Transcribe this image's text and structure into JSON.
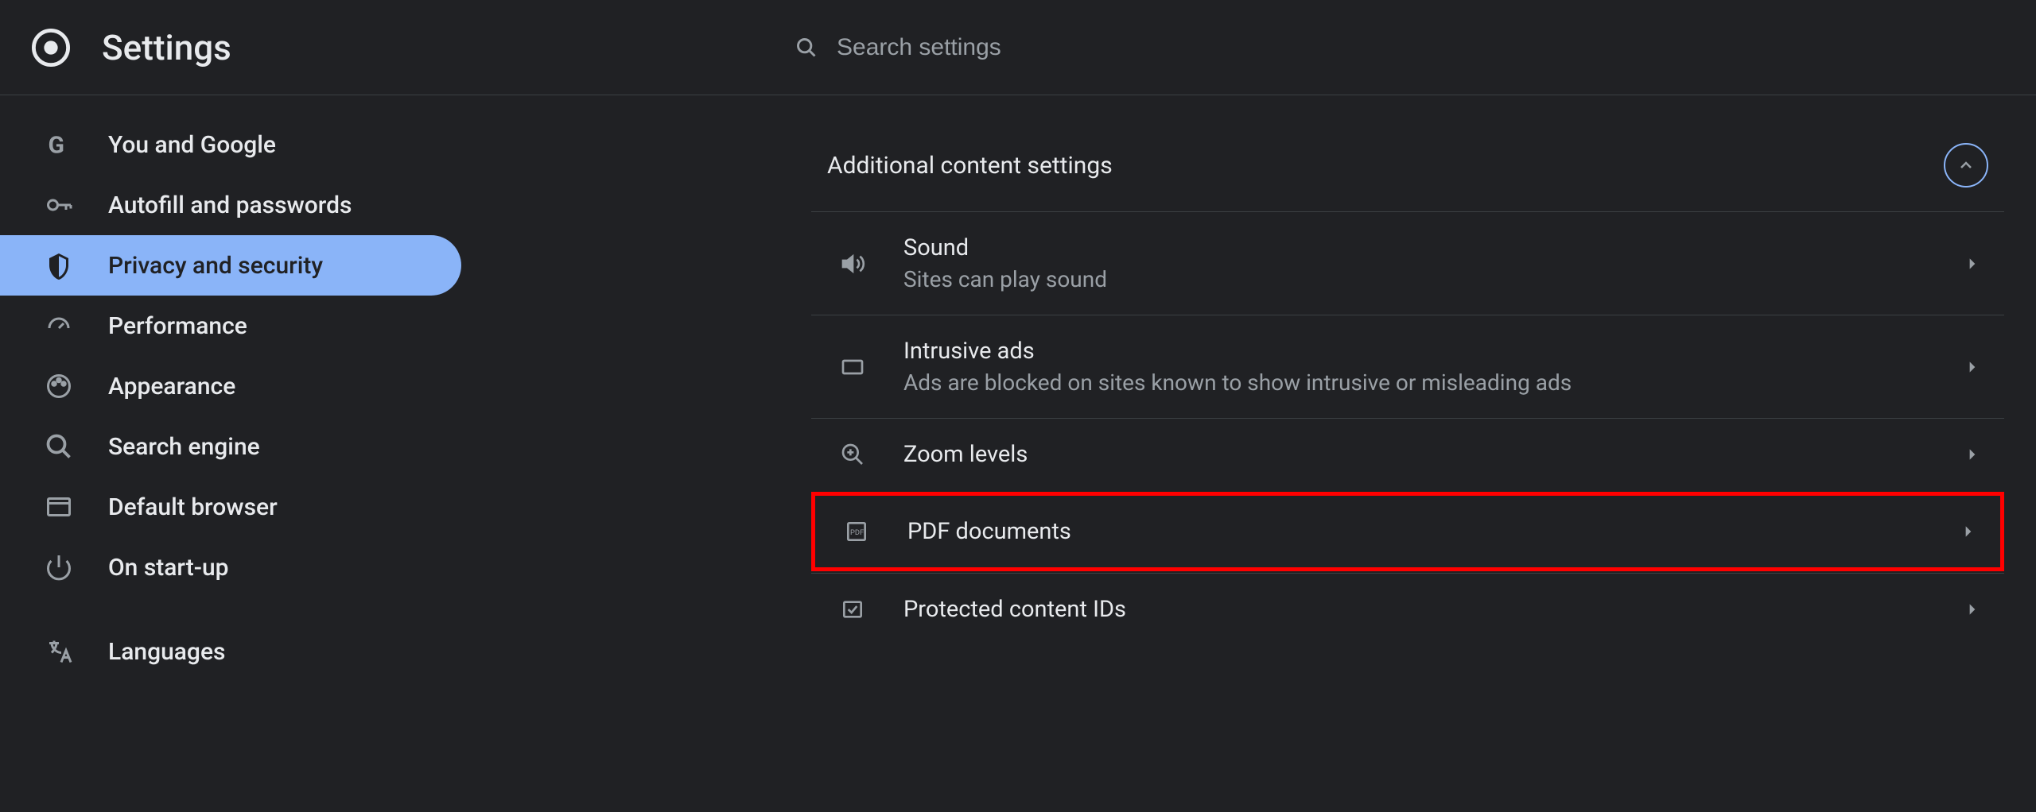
{
  "header": {
    "title": "Settings"
  },
  "search": {
    "placeholder": "Search settings"
  },
  "sidebar": {
    "items": [
      {
        "label": "You and Google",
        "icon": "google"
      },
      {
        "label": "Autofill and passwords",
        "icon": "key"
      },
      {
        "label": "Privacy and security",
        "icon": "shield",
        "active": true
      },
      {
        "label": "Performance",
        "icon": "speedometer"
      },
      {
        "label": "Appearance",
        "icon": "palette"
      },
      {
        "label": "Search engine",
        "icon": "search"
      },
      {
        "label": "Default browser",
        "icon": "browser"
      },
      {
        "label": "On start-up",
        "icon": "power"
      },
      {
        "label": "Languages",
        "icon": "translate"
      }
    ]
  },
  "main": {
    "section_title": "Additional content settings",
    "rows": [
      {
        "title": "Sound",
        "subtitle": "Sites can play sound",
        "icon": "sound"
      },
      {
        "title": "Intrusive ads",
        "subtitle": "Ads are blocked on sites known to show intrusive or misleading ads",
        "icon": "window"
      },
      {
        "title": "Zoom levels",
        "icon": "zoom"
      },
      {
        "title": "PDF documents",
        "icon": "pdf",
        "highlighted": true
      },
      {
        "title": "Protected content IDs",
        "icon": "protected"
      }
    ]
  }
}
